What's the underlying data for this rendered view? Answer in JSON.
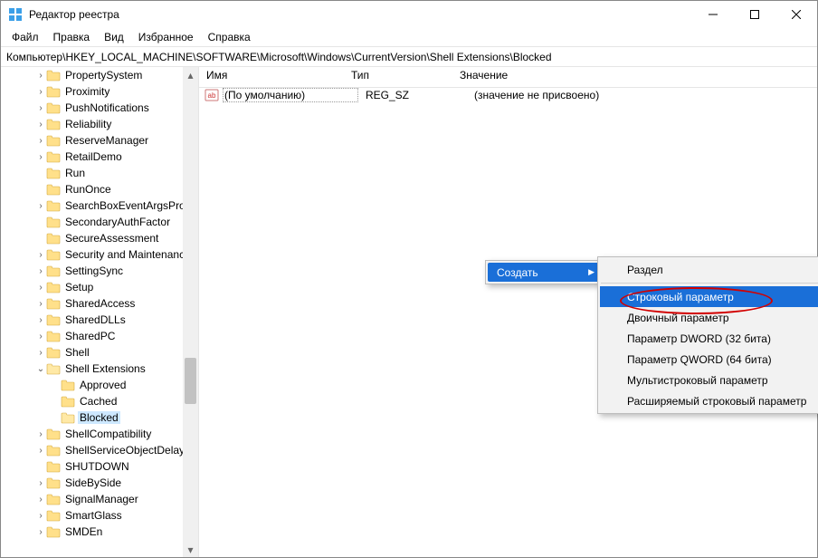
{
  "window": {
    "title": "Редактор реестра"
  },
  "menu": {
    "file": "Файл",
    "edit": "Правка",
    "view": "Вид",
    "favorites": "Избранное",
    "help": "Справка"
  },
  "address": {
    "path": "Компьютер\\HKEY_LOCAL_MACHINE\\SOFTWARE\\Microsoft\\Windows\\CurrentVersion\\Shell Extensions\\Blocked"
  },
  "tree": {
    "items": [
      {
        "indent": 2,
        "exp": ">",
        "label": "PropertySystem"
      },
      {
        "indent": 2,
        "exp": ">",
        "label": "Proximity"
      },
      {
        "indent": 2,
        "exp": ">",
        "label": "PushNotifications"
      },
      {
        "indent": 2,
        "exp": ">",
        "label": "Reliability"
      },
      {
        "indent": 2,
        "exp": ">",
        "label": "ReserveManager"
      },
      {
        "indent": 2,
        "exp": ">",
        "label": "RetailDemo"
      },
      {
        "indent": 2,
        "exp": "",
        "label": "Run"
      },
      {
        "indent": 2,
        "exp": "",
        "label": "RunOnce"
      },
      {
        "indent": 2,
        "exp": ">",
        "label": "SearchBoxEventArgsProv"
      },
      {
        "indent": 2,
        "exp": "",
        "label": "SecondaryAuthFactor"
      },
      {
        "indent": 2,
        "exp": "",
        "label": "SecureAssessment"
      },
      {
        "indent": 2,
        "exp": ">",
        "label": "Security and Maintenanc"
      },
      {
        "indent": 2,
        "exp": ">",
        "label": "SettingSync"
      },
      {
        "indent": 2,
        "exp": ">",
        "label": "Setup"
      },
      {
        "indent": 2,
        "exp": ">",
        "label": "SharedAccess"
      },
      {
        "indent": 2,
        "exp": ">",
        "label": "SharedDLLs"
      },
      {
        "indent": 2,
        "exp": ">",
        "label": "SharedPC"
      },
      {
        "indent": 2,
        "exp": ">",
        "label": "Shell"
      },
      {
        "indent": 2,
        "exp": "v",
        "label": "Shell Extensions"
      },
      {
        "indent": 3,
        "exp": "",
        "label": "Approved"
      },
      {
        "indent": 3,
        "exp": "",
        "label": "Cached"
      },
      {
        "indent": 3,
        "exp": "",
        "label": "Blocked",
        "selected": true
      },
      {
        "indent": 2,
        "exp": ">",
        "label": "ShellCompatibility"
      },
      {
        "indent": 2,
        "exp": ">",
        "label": "ShellServiceObjectDelayL"
      },
      {
        "indent": 2,
        "exp": "",
        "label": "SHUTDOWN"
      },
      {
        "indent": 2,
        "exp": ">",
        "label": "SideBySide"
      },
      {
        "indent": 2,
        "exp": ">",
        "label": "SignalManager"
      },
      {
        "indent": 2,
        "exp": ">",
        "label": "SmartGlass"
      },
      {
        "indent": 2,
        "exp": ">",
        "label": "SMDEn"
      }
    ]
  },
  "list": {
    "headers": {
      "name": "Имя",
      "type": "Тип",
      "value": "Значение"
    },
    "rows": [
      {
        "icon": "ab",
        "name": "(По умолчанию)",
        "type": "REG_SZ",
        "data": "(значение не присвоено)",
        "default": true
      }
    ]
  },
  "context": {
    "create": "Создать",
    "submenu": [
      {
        "label": "Раздел",
        "sep_after": true
      },
      {
        "label": "Строковый параметр",
        "hover": true
      },
      {
        "label": "Двоичный параметр"
      },
      {
        "label": "Параметр DWORD (32 бита)"
      },
      {
        "label": "Параметр QWORD (64 бита)"
      },
      {
        "label": "Мультистроковый параметр"
      },
      {
        "label": "Расширяемый строковый параметр"
      }
    ]
  }
}
